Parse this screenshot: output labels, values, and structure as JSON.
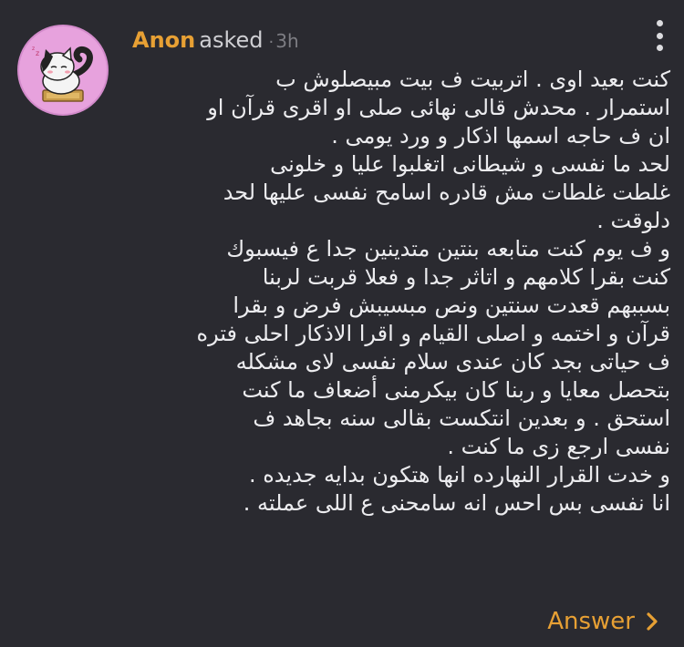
{
  "header": {
    "asker_name": "Anon",
    "asked_label": "asked",
    "separator": "·",
    "time_ago": "3h"
  },
  "question": {
    "lines": [
      "كنت بعيد اوى . اتربيت ف بيت مبيصلوش ب",
      "استمرار . محدش قالى نهائى صلى او اقرى قرآن او",
      "ان ف حاجه اسمها اذكار و ورد يومى .",
      "لحد ما نفسى و شيطانى اتغلبوا عليا و خلونى",
      "غلطت غلطات مش قادره اسامح نفسى عليها لحد",
      "دلوقت .",
      "و ف يوم كنت متابعه بنتين متدينين جدا ع فيسبوك",
      "كنت بقرا كلامهم و اتاثر جدا و فعلا قربت لربنا",
      "بسببهم قعدت سنتين ونص مبسيبش فرض و بقرا",
      "قرآن و اختمه و اصلى القيام و اقرا الاذكار احلى فتره",
      "ف حياتى بجد كان عندى سلام نفسى لاى مشكله",
      "بتحصل معايا و ربنا كان بيكرمنى أضعاف ما كنت",
      "استحق . و بعدين انتكست بقالى سنه بجاهد ف",
      "نفسى ارجع زى ما كنت .",
      "و خدت القرار النهارده انها هتكون بدايه جديده .",
      "انا نفسى بس احس انه سامحنى ع اللى عملته ."
    ]
  },
  "actions": {
    "answer_label": "Answer"
  },
  "icons": {
    "avatar": "cat-avatar",
    "menu": "more-vertical-icon",
    "answer": "chevron-right-icon"
  },
  "colors": {
    "background": "#2a2a30",
    "accent": "#e7a034",
    "avatar_bg": "#e7a2dd"
  }
}
